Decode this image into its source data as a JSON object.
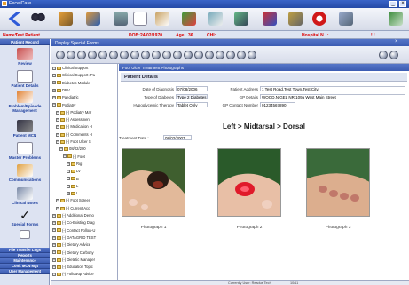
{
  "app": {
    "title": "ExcelCare"
  },
  "patient_bar": {
    "name_label": "Name:",
    "name_value": "Test Patient",
    "dob_label": "DOB:",
    "dob_value": "24/02/1970",
    "age_label": "Age:",
    "age_value": "36",
    "chi_label": "CHI:",
    "hospital_label": "Hospital N...:"
  },
  "left_nav": {
    "header": "Patient Record",
    "items": [
      {
        "label": "Review",
        "icon": "review-icon"
      },
      {
        "label": "Patient Details",
        "icon": "patient-details-icon"
      },
      {
        "label": "Problem/Episode Management",
        "icon": "problem-icon"
      },
      {
        "label": "Patient MCN",
        "icon": "mcn-icon"
      },
      {
        "label": "Master Problems",
        "icon": "master-problems-icon"
      },
      {
        "label": "Communications",
        "icon": "communications-icon"
      },
      {
        "label": "Clinical Notes",
        "icon": "clinical-notes-icon"
      },
      {
        "label": "Special Forms",
        "icon": "special-forms-icon"
      }
    ],
    "bottom": [
      "File Transfer Logs",
      "Reports",
      "Maintenance",
      "Conf. MCN Mgt",
      "User Management"
    ]
  },
  "main": {
    "header": "Display Special Forms"
  },
  "tree": [
    {
      "label": "Clinical Support",
      "indent": 0
    },
    {
      "label": "Clinical Support (Pa",
      "indent": 0
    },
    {
      "label": "Diabetes Module",
      "indent": 0
    },
    {
      "label": "DRV",
      "indent": 0
    },
    {
      "label": "Paediatric",
      "indent": 0
    },
    {
      "label": "Podiatry",
      "indent": 0
    },
    {
      "label": "(-) Podiatry Mar",
      "indent": 1
    },
    {
      "label": "(-) Assessment",
      "indent": 1
    },
    {
      "label": "(-) Medication H",
      "indent": 1
    },
    {
      "label": "(-) Comments H",
      "indent": 1
    },
    {
      "label": "(-) Foot Ulcer S",
      "indent": 1
    },
    {
      "label": "08/02/200",
      "indent": 2
    },
    {
      "label": "(-) Foot",
      "indent": 3
    },
    {
      "label": "Rig",
      "indent": 4
    },
    {
      "label": "LV",
      "indent": 4
    },
    {
      "label": "B",
      "indent": 4
    },
    {
      "label": "L",
      "indent": 4
    },
    {
      "label": "L",
      "indent": 4
    },
    {
      "label": "(-) Foot Screen",
      "indent": 1
    },
    {
      "label": "(-) Current Acc",
      "indent": 1
    },
    {
      "label": "(-) Additional Demo",
      "indent": 0
    },
    {
      "label": "(-) Co-Existing Diag",
      "indent": 0
    },
    {
      "label": "(-) Contact Follow-U",
      "indent": 0
    },
    {
      "label": "(-) DATAGRID TEST",
      "indent": 0
    },
    {
      "label": "(-) Dietary Advice",
      "indent": 0
    },
    {
      "label": "(-) Dietary Carbohy",
      "indent": 0
    },
    {
      "label": "(-) Dietetic Manager",
      "indent": 0
    },
    {
      "label": "(-) Education Topic",
      "indent": 0
    },
    {
      "label": "(-) Followup Advice",
      "indent": 0
    }
  ],
  "form": {
    "header": "Foot Ulcer Treatment Photographs",
    "section_title": "Patient Details",
    "date_of_diagnosis_label": "Date of Diagnosis",
    "date_of_diagnosis_value": "07/08/2006",
    "type_of_diabetes_label": "Type of Diabetes",
    "type_of_diabetes_value": "Type 2 Diabetes",
    "hypoglycemic_label": "Hypoglycemic Therapy",
    "hypoglycemic_value": "Tablet Only",
    "patient_address_label": "Patient Address",
    "patient_address_value": "1 Test Road,Test Town,Test City,",
    "gp_details_label": "GP Details",
    "gp_details_value": "WOOD,NIGEL NR 109a West Main Street",
    "gp_contact_label": "GP Contact Number",
    "gp_contact_value": "01234567890",
    "treatment_date_label": "Treatment Date :",
    "treatment_date_value": "08/02/2007",
    "location_heading": "Left > Midtarsal > Dorsal",
    "photos": [
      {
        "caption": "Photograph 1"
      },
      {
        "caption": "Photograph 2"
      },
      {
        "caption": "Photograph 3"
      }
    ]
  },
  "statusbar": {
    "user": "Currently User: Readus Tech",
    "build": "10/11"
  },
  "colors": {
    "header_blue": "#3c5cb2",
    "nav_bg": "#dde3f2",
    "accent_red": "#dd0000"
  }
}
